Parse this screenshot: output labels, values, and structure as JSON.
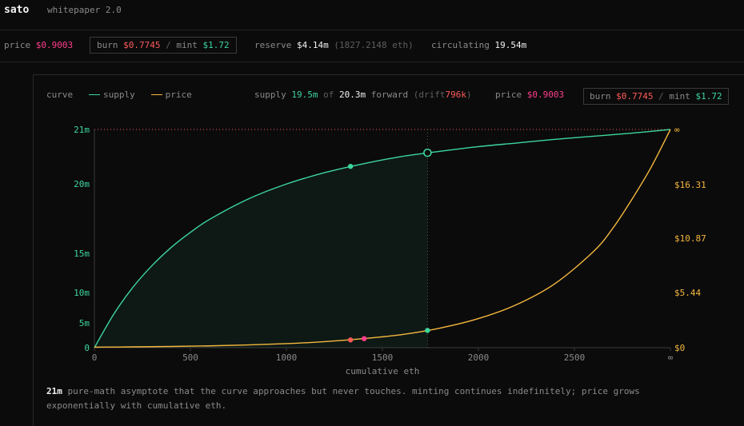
{
  "header": {
    "brand": "sato",
    "subtitle": "whitepaper 2.0"
  },
  "stats": {
    "price_label": "price",
    "price_value": "$0.9003",
    "burn_label": "burn",
    "burn_value": "$0.7745",
    "sep": "/",
    "mint_label": "mint",
    "mint_value": "$1.72",
    "reserve_label": "reserve",
    "reserve_value": "$4.14m",
    "reserve_eth": "(1827.2148 eth)",
    "circ_label": "circulating",
    "circ_value": "19.54m"
  },
  "panel": {
    "curve_label": "curve",
    "legend_supply": "supply",
    "legend_price": "price",
    "supply_label": "supply",
    "supply_value": "19.5m",
    "of": "of",
    "forward_value": "20.3m",
    "forward_label": "forward",
    "drift_label": "(drift",
    "drift_value": "796k",
    "drift_close": ")",
    "price_label": "price",
    "price_value": "$0.9003",
    "burn_label": "burn",
    "burn_value": "$0.7745",
    "sep": "/",
    "mint_label": "mint",
    "mint_value": "$1.72"
  },
  "colors": {
    "supply": "#3dd69c",
    "price": "#f5b83d",
    "pink": "#ff3d8a",
    "red": "#ff5a5a",
    "grid": "#2a2a2a"
  },
  "chart_data": {
    "type": "line",
    "xlabel": "cumulative eth",
    "x_ticks": [
      "0",
      "500",
      "1000",
      "1500",
      "2000",
      "2500",
      "∞"
    ],
    "y_left_ticks": [
      "0",
      "5m",
      "10m",
      "15m",
      "20m",
      "21m"
    ],
    "y_right_ticks": [
      "$0",
      "$5.44",
      "$10.87",
      "$16.31",
      "∞"
    ],
    "xlim": [
      0,
      3000
    ],
    "ylim_supply": [
      0,
      21000000
    ],
    "ylim_price": [
      0,
      21.75
    ],
    "series": [
      {
        "name": "supply",
        "x": [
          0,
          100,
          200,
          300,
          400,
          500,
          600,
          800,
          1000,
          1200,
          1400,
          1600,
          1800,
          2000,
          2200,
          2400,
          2600,
          2800,
          3000
        ],
        "y": [
          0,
          3200000,
          5800000,
          7900000,
          9650000,
          11100000,
          12350000,
          14300000,
          15750000,
          16850000,
          17700000,
          18400000,
          18900000,
          19350000,
          19700000,
          20050000,
          20350000,
          20650000,
          21000000
        ]
      },
      {
        "name": "price",
        "x": [
          0,
          200,
          400,
          600,
          800,
          1000,
          1200,
          1400,
          1600,
          1800,
          2000,
          2200,
          2400,
          2600,
          2700,
          2800,
          2900,
          3000
        ],
        "y": [
          0.05,
          0.08,
          0.12,
          0.18,
          0.27,
          0.4,
          0.6,
          0.9,
          1.3,
          1.95,
          2.9,
          4.3,
          6.4,
          9.6,
          11.9,
          14.8,
          18.0,
          21.75
        ]
      }
    ],
    "markers": [
      {
        "series": "supply",
        "x": 1334,
        "y": 17450000,
        "kind": "dot"
      },
      {
        "series": "supply",
        "x": 1735,
        "y": 18760000,
        "kind": "ring"
      },
      {
        "series": "price",
        "x": 1334,
        "y": 0.7745,
        "kind": "burn"
      },
      {
        "series": "price",
        "x": 1405,
        "y": 0.9003,
        "kind": "price"
      },
      {
        "series": "price",
        "x": 1735,
        "y": 1.72,
        "kind": "mint"
      }
    ],
    "asymptote": 21000000,
    "forward_x": 1735
  },
  "footnote": {
    "lead": "21m",
    "text": "pure-math asymptote that the curve approaches but never touches. minting continues indefinitely; price grows exponentially with cumulative eth."
  }
}
